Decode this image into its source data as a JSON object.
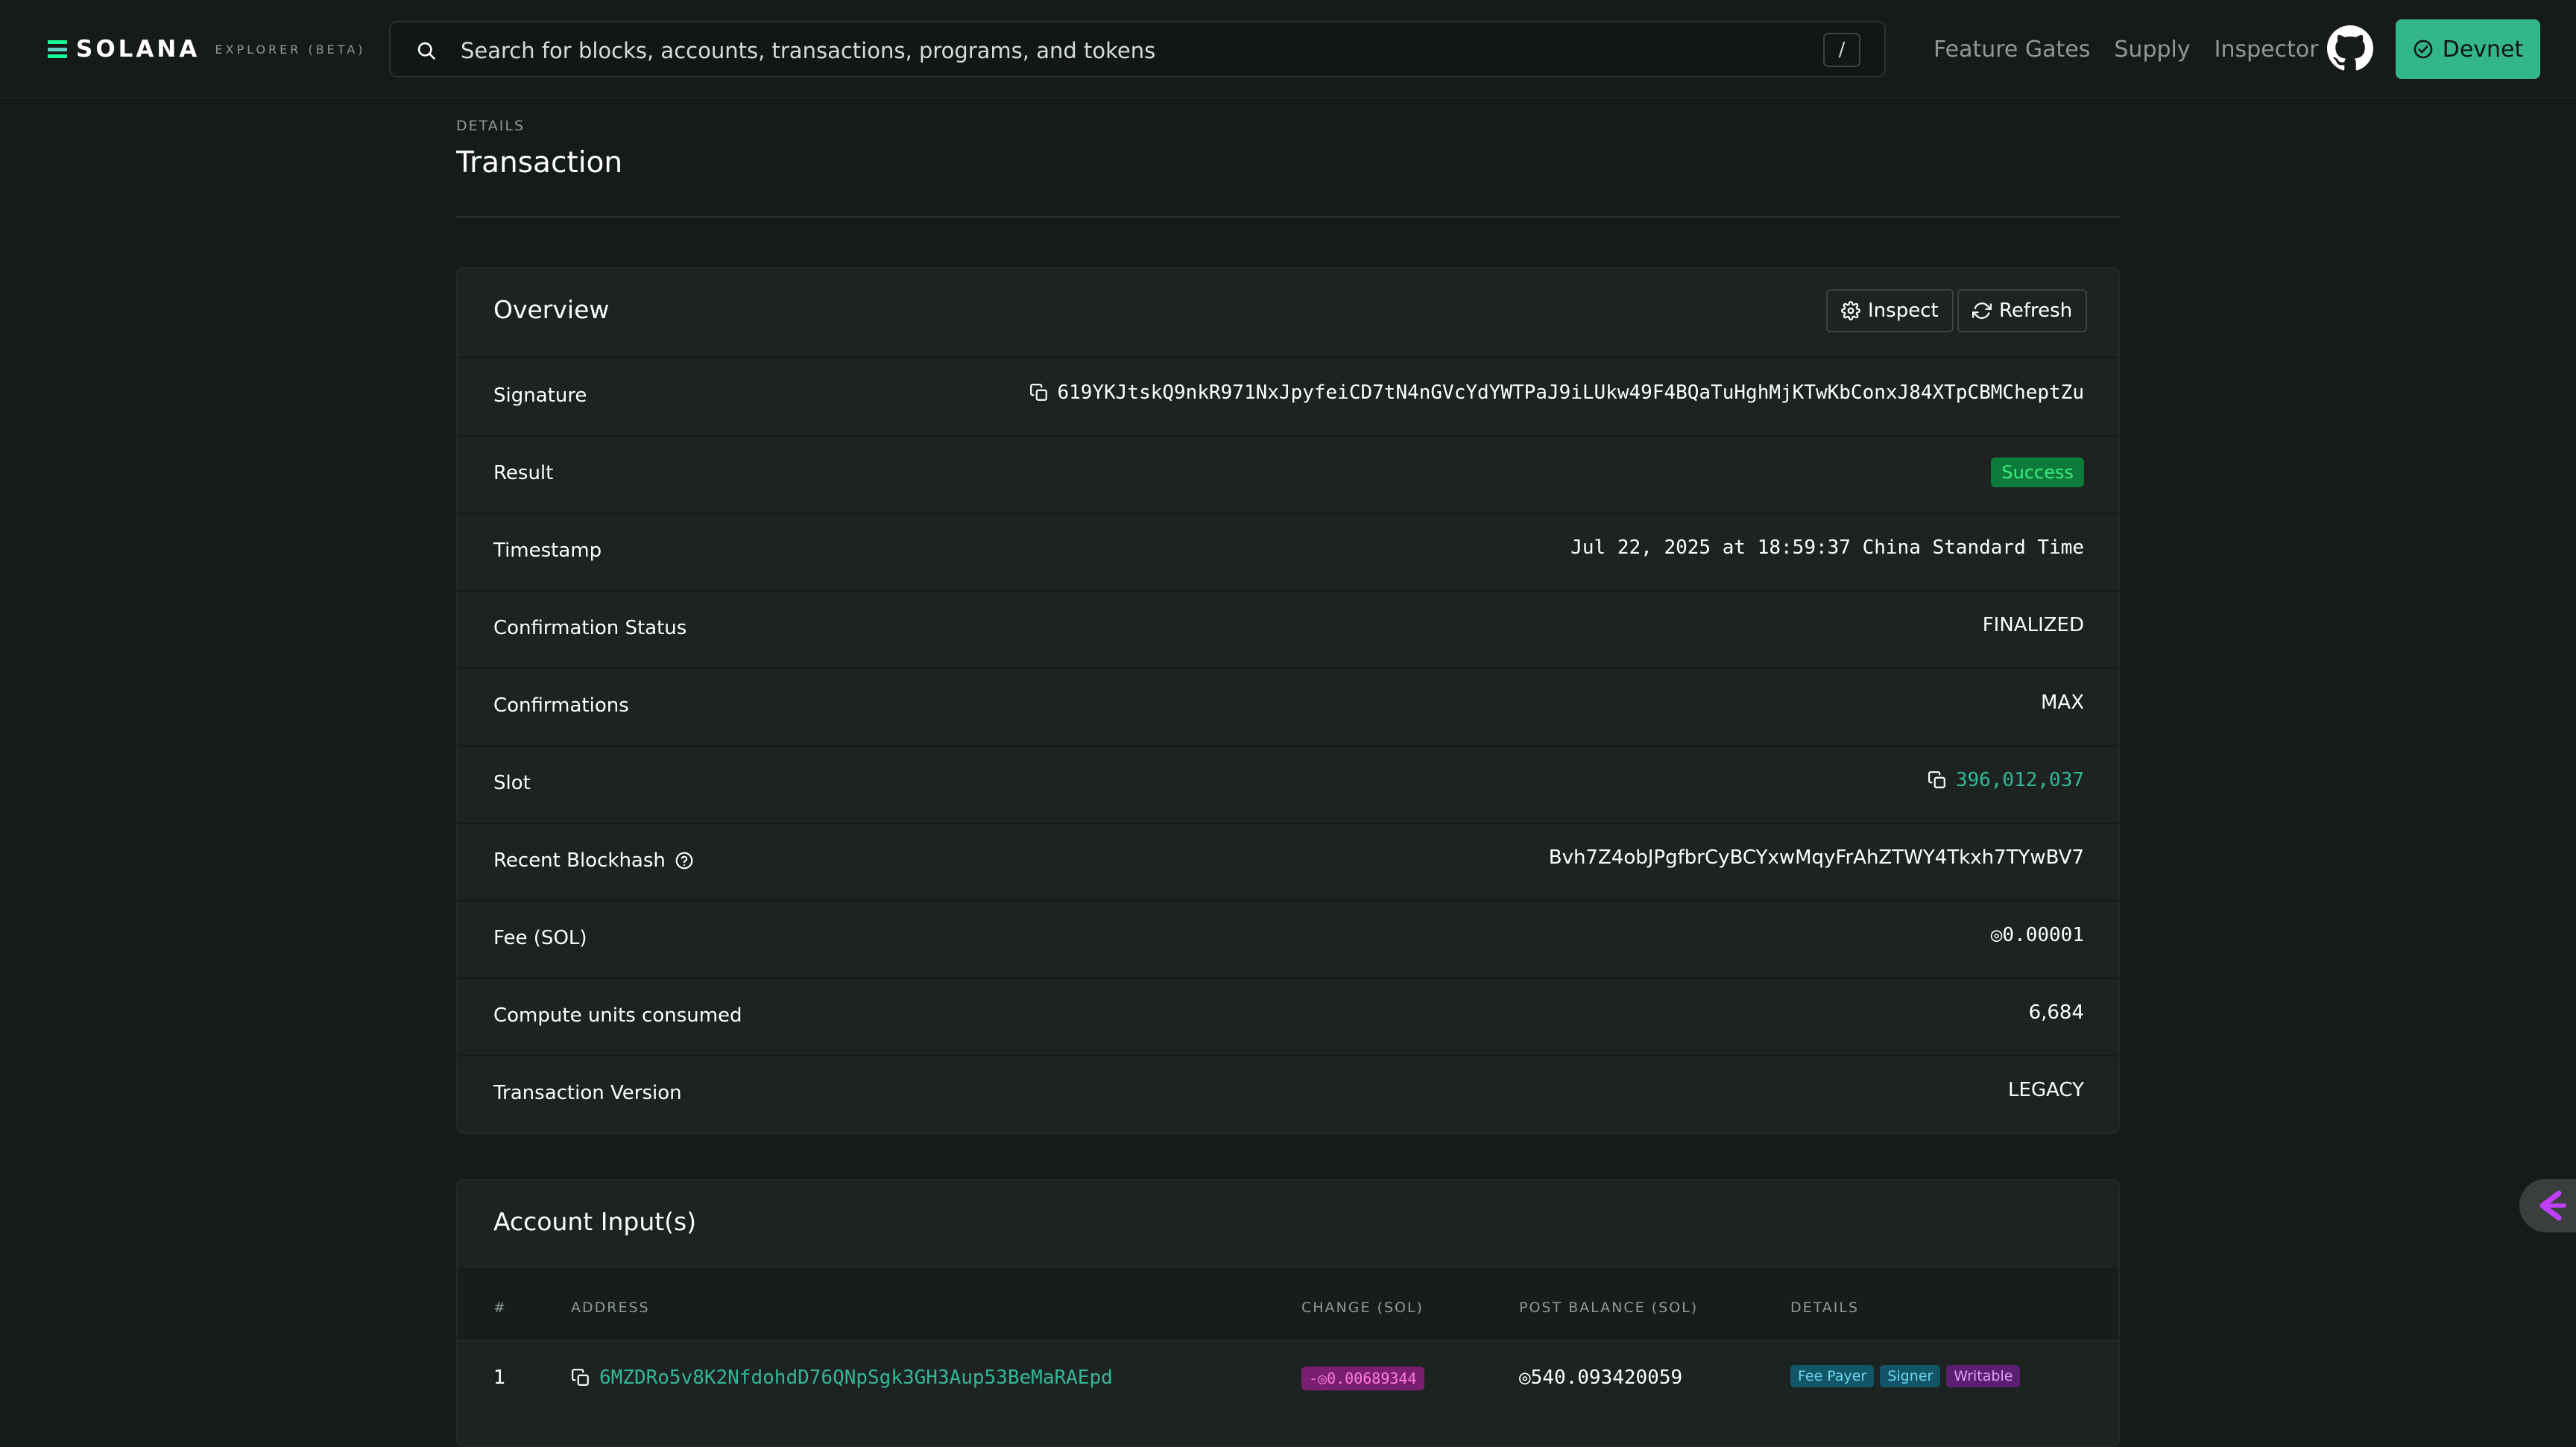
{
  "brand": {
    "name": "SOLANA",
    "sub": "EXPLORER (BETA)"
  },
  "search": {
    "placeholder": "Search for blocks, accounts, transactions, programs, and tokens",
    "shortcut": "/"
  },
  "nav": {
    "links": [
      "Feature Gates",
      "Supply",
      "Inspector"
    ],
    "cluster_label": "Devnet"
  },
  "page": {
    "pretitle": "DETAILS",
    "title": "Transaction"
  },
  "overview": {
    "title": "Overview",
    "inspect_label": "Inspect",
    "refresh_label": "Refresh",
    "rows": [
      {
        "label": "Signature",
        "value": "619YKJtskQ9nkR971NxJpyfeiCD7tN4nGVcYdYWTPaJ9iLUkw49F4BQaTuHghMjKTwKbConxJ84XTpCBMCheptZu"
      },
      {
        "label": "Result",
        "value": "Success"
      },
      {
        "label": "Timestamp",
        "value": "Jul 22, 2025 at 18:59:37 China Standard Time"
      },
      {
        "label": "Confirmation Status",
        "value": "FINALIZED"
      },
      {
        "label": "Confirmations",
        "value": "MAX"
      },
      {
        "label": "Slot",
        "value": "396,012,037"
      },
      {
        "label": "Recent Blockhash",
        "value": "Bvh7Z4obJPgfbrCyBCYxwMqyFrAhZTWY4Tkxh7TYwBV7"
      },
      {
        "label": "Fee (SOL)",
        "value": "◎0.00001"
      },
      {
        "label": "Compute units consumed",
        "value": "6,684"
      },
      {
        "label": "Transaction Version",
        "value": "LEGACY"
      }
    ]
  },
  "accounts": {
    "title": "Account Input(s)",
    "columns": [
      "#",
      "ADDRESS",
      "CHANGE (SOL)",
      "POST BALANCE (SOL)",
      "DETAILS"
    ],
    "rows": [
      {
        "index": "1",
        "address": "6MZDRo5v8K2NfdohdD76QNpSgk3GH3Aup53BeMaRAEpd",
        "change": "-◎0.00689344",
        "post_balance": "◎540.093420059",
        "tags": [
          "Fee Payer",
          "Signer",
          "Writable"
        ]
      }
    ]
  },
  "colors": {
    "accent_green": "#33b68c",
    "link_teal": "#34b69a",
    "success_bg": "#0c7a3a",
    "background": "#161b19"
  }
}
